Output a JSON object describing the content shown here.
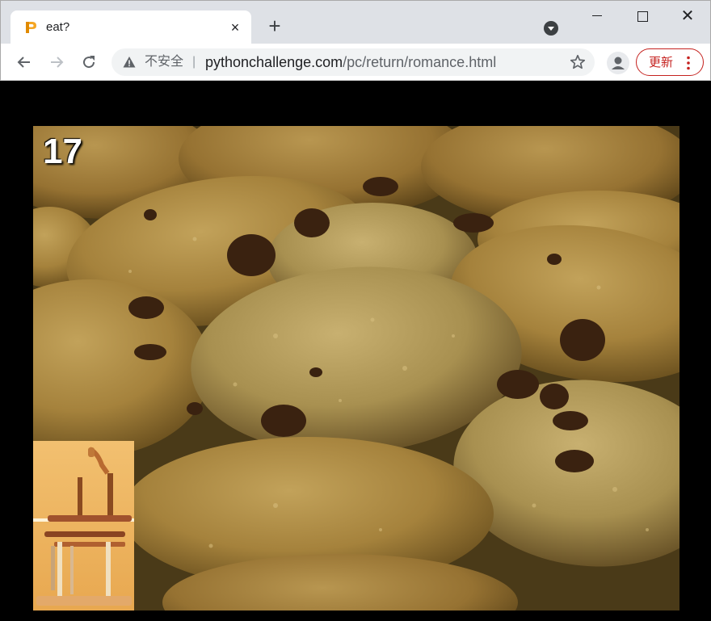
{
  "tab": {
    "title": "eat?",
    "favicon": "python-challenge-logo-icon",
    "close_label": "×"
  },
  "tabstrip": {
    "new_tab_label": "+",
    "close_window_label": "✕"
  },
  "toolbar": {
    "security_label": "不安全",
    "separator": "|",
    "url_host": "pythonchallenge.com",
    "url_path": "/pc/return/romance.html",
    "update_label": "更新"
  },
  "page": {
    "level_number": "17",
    "main_image": "chocolate-chip-cookies-photo",
    "inset_image": "wooden-loom-photo"
  },
  "colors": {
    "background": "#000000",
    "update_accent": "#c5221f",
    "tabstrip": "#dee1e6",
    "omnibox": "#f1f3f4"
  }
}
